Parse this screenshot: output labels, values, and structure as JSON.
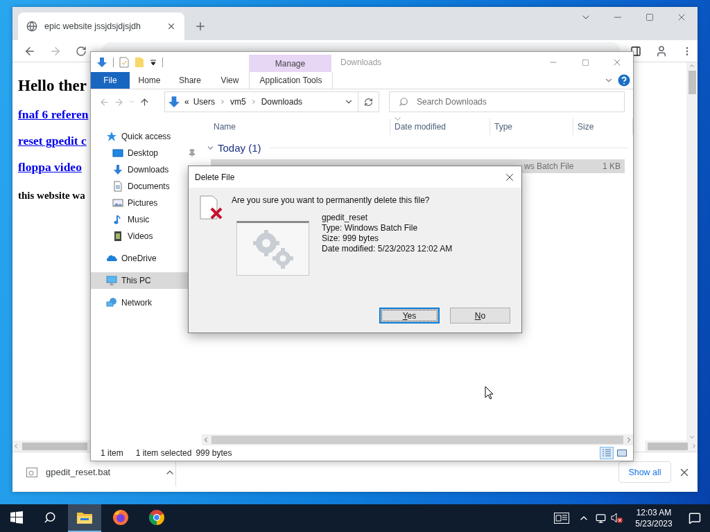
{
  "browser": {
    "tab": {
      "title": "epic website jssjdsjdjsjdh",
      "selected": true
    },
    "page": {
      "heading": "Hello ther",
      "links": [
        "fnaf 6 referen",
        "reset gpedit c",
        "floppa video"
      ],
      "note": "this website wa"
    },
    "download": {
      "file": "gpedit_reset.bat",
      "show_all": "Show all"
    }
  },
  "explorer": {
    "title": "Downloads",
    "context_label": "Manage",
    "tabs": [
      {
        "label": "File",
        "kind": "file"
      },
      {
        "label": "Home",
        "kind": "tab"
      },
      {
        "label": "Share",
        "kind": "tab"
      },
      {
        "label": "View",
        "kind": "tab"
      },
      {
        "label": "Application Tools",
        "kind": "contextual"
      }
    ],
    "overflow": "«",
    "breadcrumb": [
      "Users",
      "vm5",
      "Downloads"
    ],
    "search": {
      "placeholder": "Search Downloads"
    },
    "nav": [
      {
        "label": "Quick access",
        "kind": "quick",
        "selected": false,
        "children": [
          {
            "label": "Desktop",
            "kind": "desktop",
            "selected": false,
            "pinned": true
          },
          {
            "label": "Downloads",
            "kind": "downloads",
            "selected": false
          },
          {
            "label": "Documents",
            "kind": "documents",
            "selected": false
          },
          {
            "label": "Pictures",
            "kind": "pictures",
            "selected": false
          },
          {
            "label": "Music",
            "kind": "music",
            "selected": false
          },
          {
            "label": "Videos",
            "kind": "videos",
            "selected": false
          }
        ]
      },
      {
        "label": "OneDrive",
        "kind": "onedrive",
        "selected": false
      },
      {
        "label": "This PC",
        "kind": "pc",
        "selected": true
      },
      {
        "label": "Network",
        "kind": "network",
        "selected": false
      }
    ],
    "columns": [
      {
        "label": "Name",
        "sorted": false
      },
      {
        "label": "Date modified",
        "sorted": true
      },
      {
        "label": "Type",
        "sorted": false
      },
      {
        "label": "Size",
        "sorted": false
      }
    ],
    "group": {
      "label": "Today (1)",
      "expanded": true
    },
    "rows": [
      {
        "type": "ws Batch File",
        "size": "1 KB",
        "selected": true
      }
    ],
    "status": {
      "count": "1 item",
      "selection": "1 item selected",
      "size": "999 bytes"
    },
    "views": [
      {
        "kind": "details",
        "selected": true
      },
      {
        "kind": "tiles",
        "selected": false
      }
    ]
  },
  "dialog": {
    "title": "Delete File",
    "question": "Are you sure you want to permanently delete this file?",
    "file": {
      "name": "gpedit_reset",
      "lines": [
        "Type: Windows Batch File",
        "Size: 999 bytes",
        "Date modified: 5/23/2023 12:02 AM"
      ]
    },
    "buttons": [
      {
        "label": "Yes",
        "selected": true
      },
      {
        "label": "No",
        "selected": false
      }
    ]
  },
  "taskbar": {
    "apps": [
      {
        "kind": "explorer",
        "selected": true
      },
      {
        "kind": "firefox",
        "selected": false
      },
      {
        "kind": "chrome",
        "selected": false
      }
    ],
    "time": "12:03 AM",
    "date": "5/23/2023"
  }
}
